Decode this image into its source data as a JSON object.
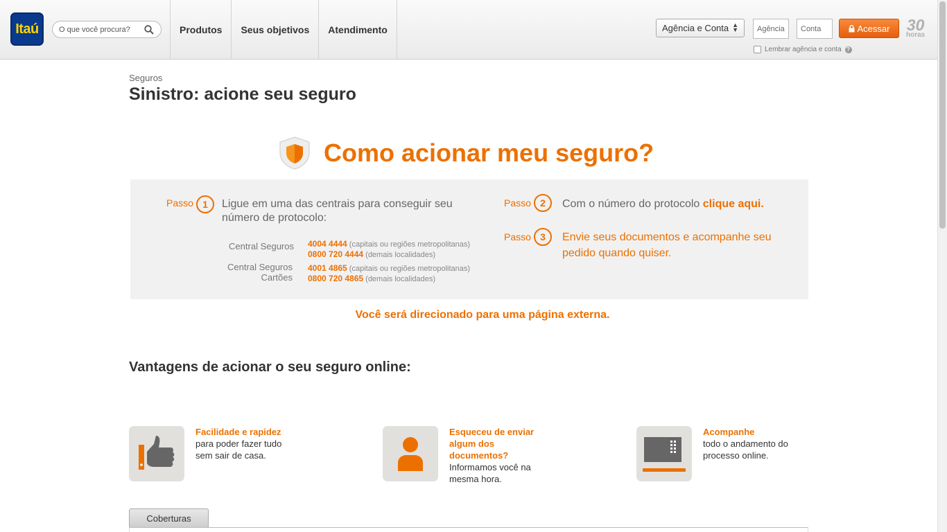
{
  "header": {
    "logo_text": "Itaú",
    "search_placeholder": "O que você procura?",
    "nav": [
      "Produtos",
      "Seus objetivos",
      "Atendimento"
    ],
    "select_value": "Agência e Conta",
    "agencia_placeholder": "Agência",
    "conta_placeholder": "Conta",
    "acessar_label": "Acessar",
    "badge_number": "30",
    "badge_text": "horas",
    "remember_label": "Lembrar agência e conta",
    "help_glyph": "?"
  },
  "breadcrumb": "Seguros",
  "page_title": "Sinistro: acione seu seguro",
  "hero_title": "Como acionar meu seguro?",
  "steps": {
    "passo_label": "Passo",
    "step1": {
      "number": "1",
      "text": "Ligue em uma das centrais para conseguir seu número de protocolo:"
    },
    "step2": {
      "number": "2",
      "text_prefix": "Com o número do protocolo ",
      "link": "clique aqui."
    },
    "step3": {
      "number": "3",
      "text": "Envie seus documentos e acompanhe seu pedido quando quiser."
    },
    "centrals": [
      {
        "label": "Central  Seguros",
        "phone1": "4004 4444",
        "desc1": "(capitais ou regiões metropolitanas)",
        "phone2": "0800 720 4444",
        "desc2": "(demais localidades)"
      },
      {
        "label_line1": "Central Seguros",
        "label_line2": "Cartões",
        "phone1": "4001 4865",
        "desc1": "(capitais ou regiões metropolitanas)",
        "phone2": "0800 720 4865",
        "desc2": "(demais localidades)"
      }
    ]
  },
  "external_notice": "Você será direcionado para uma página externa.",
  "advantages_title": "Vantagens de acionar o seu seguro online:",
  "advantages": [
    {
      "title": "Facilidade e rapidez",
      "text": "para poder fazer tudo sem sair de casa.",
      "icon": "thumbs-up-icon"
    },
    {
      "title": "Esqueceu de enviar algum dos documentos?",
      "text": "Informamos você na mesma hora.",
      "icon": "person-icon"
    },
    {
      "title": "Acompanhe",
      "text": "todo o andamento do processo online.",
      "icon": "tablet-icon"
    }
  ],
  "tab_label": "Coberturas",
  "colors": {
    "accent": "#ec7000",
    "logo_bg": "#0a3a8c",
    "logo_text": "#ffd200"
  }
}
